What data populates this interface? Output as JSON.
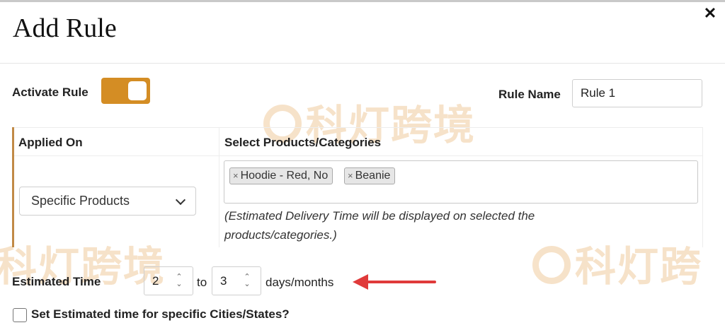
{
  "dialog": {
    "title": "Add Rule",
    "close_icon": "close-icon"
  },
  "activate_rule": {
    "label": "Activate Rule",
    "enabled": true,
    "toggle_color": "#d48d24"
  },
  "rule_name": {
    "label": "Rule Name",
    "value": "Rule 1"
  },
  "table": {
    "col_applied_on": "Applied On",
    "col_select": "Select Products/Categories",
    "applied_on_selected": "Specific Products",
    "selected_items": [
      {
        "label": "Hoodie - Red, No",
        "remove": "×"
      },
      {
        "label": "Beanie",
        "remove": "×"
      }
    ],
    "note": "(Estimated Delivery Time will be displayed on selected the products/categories.)"
  },
  "estimated_time": {
    "label": "Estimated Time",
    "from": "2",
    "to_label": "to",
    "to": "3",
    "unit_label": "days/months"
  },
  "specific_locations": {
    "label": "Set Estimated time for specific Cities/States?",
    "checked": false
  },
  "watermark": {
    "text": "科灯跨境",
    "text_short": "科灯跨"
  },
  "annotation": {
    "arrow_color": "#e03a3a"
  }
}
